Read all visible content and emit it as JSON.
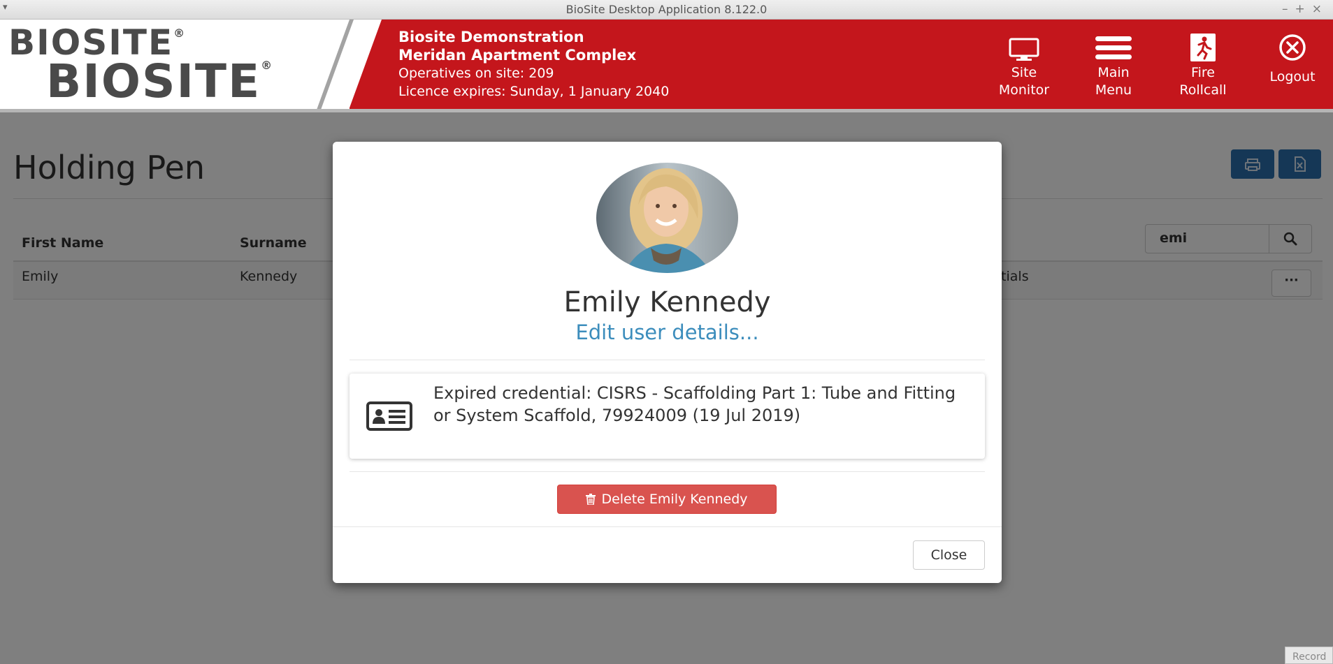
{
  "window": {
    "title": "BioSite Desktop Application 8.122.0",
    "controls": [
      "–",
      "+",
      "×"
    ]
  },
  "header": {
    "logo_text": "BIOSITE",
    "logo_mark": "®",
    "company": "Biosite Demonstration",
    "site": "Meridan Apartment Complex",
    "operatives": "Operatives on site: 209",
    "licence": "Licence expires: Sunday, 1 January 2040",
    "buttons": [
      {
        "line1": "Site",
        "line2": "Monitor",
        "icon": "monitor-icon"
      },
      {
        "line1": "Main",
        "line2": "Menu",
        "icon": "hamburger-icon"
      },
      {
        "line1": "Fire",
        "line2": "Rollcall",
        "icon": "fire-exit-icon"
      },
      {
        "line1": "Logout",
        "line2": "",
        "icon": "close-circle-icon"
      }
    ]
  },
  "page": {
    "title": "Holding Pen",
    "search_value": "emi",
    "columns": [
      "First Name",
      "Surname"
    ],
    "row": {
      "first_name": "Emily",
      "surname": "Kennedy",
      "status_fragment": "ntials",
      "actions_label": "···"
    }
  },
  "modal": {
    "name": "Emily Kennedy",
    "edit_link": "Edit user details...",
    "credential_message": "Expired credential: CISRS - Scaffolding Part 1: Tube and Fitting or System Scaffold, 79924009 (19 Jul 2019)",
    "delete_label": "Delete Emily Kennedy",
    "close_label": "Close"
  },
  "footer": {
    "record_tab": "Record"
  }
}
